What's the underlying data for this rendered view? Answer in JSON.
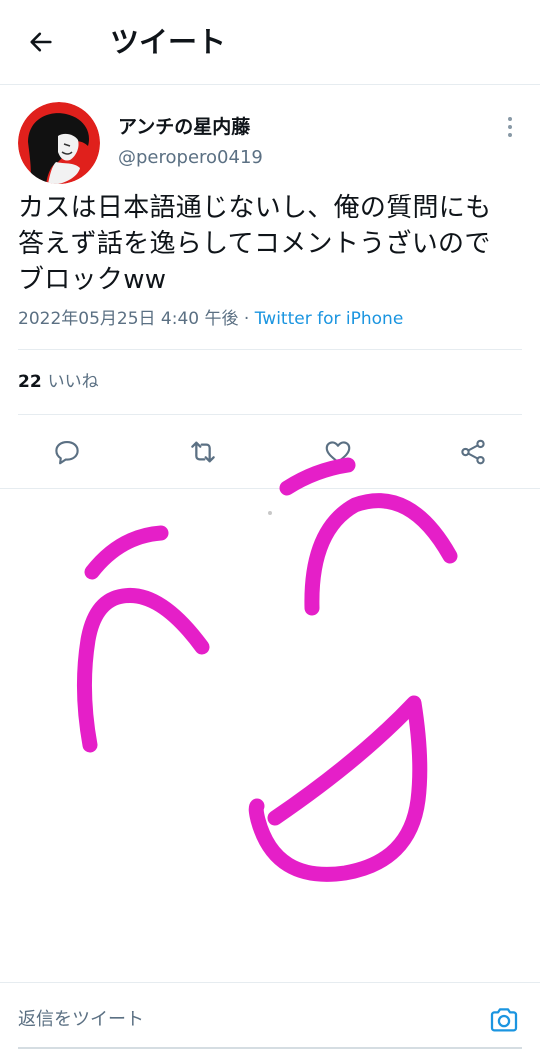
{
  "header": {
    "title": "ツイート",
    "back_icon": "arrow-left-icon"
  },
  "tweet": {
    "display_name": "アンチの星内藤",
    "username": "@peropero0419",
    "text_lines": [
      "カスは日本語通じないし、俺の質問にも",
      "答えず話を逸らしてコメントうざいので",
      "ブロックww"
    ],
    "timestamp": "2022年05月25日 4:40 午後",
    "separator": " · ",
    "source": "Twitter for iPhone",
    "like_count": "22",
    "like_label": "いいね"
  },
  "actions": [
    {
      "name": "reply",
      "icon": "reply-icon"
    },
    {
      "name": "retweet",
      "icon": "retweet-icon"
    },
    {
      "name": "like",
      "icon": "heart-icon"
    },
    {
      "name": "share",
      "icon": "share-icon"
    }
  ],
  "reply_bar": {
    "placeholder": "返信をツイート",
    "icon": "camera-icon"
  },
  "colors": {
    "text": "#0f1419",
    "secondary": "#5b7083",
    "link": "#1b95e0",
    "divider": "#e6ecf0",
    "drawing": "#e51fc8",
    "avatar_bg": "#e0201c"
  }
}
